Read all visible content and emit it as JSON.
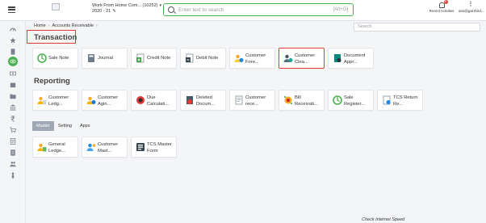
{
  "header": {
    "company_line1": "Work From Home Com... (10252)",
    "company_line2": "2020 - 21",
    "search_placeholder": "Enter text to search",
    "search_shortcut": "[Alt+G]",
    "recent_label": "Recent Activities",
    "recent_badge": "6",
    "user_label": "ans@gal.third...",
    "user_menu_glyph": "⋮"
  },
  "breadcrumb": {
    "home": "Home",
    "sep1": "›",
    "current": "Accounts Receivable",
    "sep2": "›"
  },
  "page_search_placeholder": "Search",
  "sections": {
    "transaction": "Transaction",
    "reporting": "Reporting"
  },
  "transaction_tiles": [
    {
      "label": "Sale Note",
      "icon": "sale-note-icon"
    },
    {
      "label": "Journal",
      "icon": "journal-icon"
    },
    {
      "label": "Credit Note",
      "icon": "credit-note-icon"
    },
    {
      "label": "Debit Note",
      "icon": "debit-note-icon"
    },
    {
      "label": "Customer Fore...",
      "icon": "customer-forex-icon"
    },
    {
      "label": "Customer Clea...",
      "icon": "customer-clearing-icon"
    },
    {
      "label": "Document Appr...",
      "icon": "document-approval-icon"
    }
  ],
  "reporting_tiles": [
    {
      "label": "Customer Ledg...",
      "icon": "customer-ledger-icon"
    },
    {
      "label": "Customer Agin...",
      "icon": "customer-ageing-icon"
    },
    {
      "label": "Due Calculati...",
      "icon": "due-calculation-icon"
    },
    {
      "label": "Deleted Docum...",
      "icon": "deleted-documents-icon"
    },
    {
      "label": "Customer rece...",
      "icon": "customer-receipts-icon"
    },
    {
      "label": "Bill Receivab...",
      "icon": "bill-receivable-icon"
    },
    {
      "label": "Sale Register...",
      "icon": "sale-register-icon"
    },
    {
      "label": "TCS Return Re...",
      "icon": "tcs-return-icon"
    }
  ],
  "tabs": [
    "Master",
    "Setting",
    "Apps"
  ],
  "master_tiles": [
    {
      "label": "General Ledge...",
      "icon": "general-ledger-icon"
    },
    {
      "label": "Customer Mast...",
      "icon": "customer-master-icon"
    },
    {
      "label": "TCS Master Form",
      "icon": "tcs-master-icon"
    }
  ],
  "tile_star_glyph": "☆",
  "footer_link": "Check Internet Speed",
  "colors": {
    "accent": "#4caf50",
    "highlight": "#e53935",
    "active_tab": "#9ea7b3"
  }
}
